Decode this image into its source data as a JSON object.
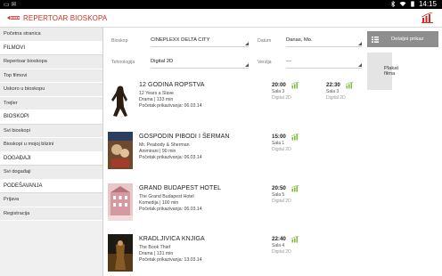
{
  "status_bar": {
    "left_text": "▭ ✉",
    "time": "14:15"
  },
  "app": {
    "title": "REPERTOAR BIOSKOPA",
    "accent": "#d52b1e"
  },
  "sidebar": {
    "rows": [
      {
        "label": "Početna stranica",
        "kind": "item"
      },
      {
        "label": "FILMOVI",
        "kind": "header"
      },
      {
        "label": "Repertoar bioskopa",
        "kind": "item"
      },
      {
        "label": "Top filmovi",
        "kind": "item"
      },
      {
        "label": "Uskoro u bioskopu",
        "kind": "item"
      },
      {
        "label": "Trejler",
        "kind": "item"
      },
      {
        "label": "BIOSKOPI",
        "kind": "header"
      },
      {
        "label": "Svi bioskopi",
        "kind": "item"
      },
      {
        "label": "Bioskopi u mojoj blizini",
        "kind": "item"
      },
      {
        "label": "DOGAĐAJI",
        "kind": "header"
      },
      {
        "label": "Svi događaji",
        "kind": "item"
      },
      {
        "label": "PODEŠAVANJA",
        "kind": "header"
      },
      {
        "label": "Prijava",
        "kind": "item"
      },
      {
        "label": "Registracija",
        "kind": "item"
      }
    ]
  },
  "filters": {
    "cinema_label": "Bioskop",
    "cinema_value": "CINEPLEXX DELTA CITY",
    "date_label": "Datum",
    "date_value": "Danas, Mo.",
    "tech_label": "Tehnologija",
    "tech_value": "Digital 2D",
    "version_label": "Verzija",
    "version_value": "---"
  },
  "view_buttons": {
    "detail": "Detaljni prikaz",
    "poster": "Plakat filma"
  },
  "movies": [
    {
      "title": "12 GODINA ROPSTVA",
      "original": "12 Years a Slave",
      "genre": "Drama | 133 min",
      "start": "Početak prikazivanja: 06.03.14",
      "shows": [
        {
          "time": "20:00",
          "hall": "Sala 3",
          "format": "Digital 2D"
        },
        {
          "time": "22:30",
          "hall": "Sala 3",
          "format": "Digital 2D"
        }
      ]
    },
    {
      "title": "GOSPODIN PIBODI I ŠERMAN",
      "original": "Mr. Peabody & Sherman",
      "genre": "Animirani | 90 min",
      "start": "Početak prikazivanja: 06.03.14",
      "shows": [
        {
          "time": "15:00",
          "hall": "Sala 1",
          "format": "Digital 2D"
        }
      ]
    },
    {
      "title": "GRAND BUDAPEST HOTEL",
      "original": "The Grand Budapest Hotel",
      "genre": "Komedija | 100 min",
      "start": "Početak prikazivanja: 06.03.14",
      "shows": [
        {
          "time": "20:50",
          "hall": "Sala 5",
          "format": "Digital 2D"
        }
      ]
    },
    {
      "title": "KRADLJIVICA KNJIGA",
      "original": "The Book Thief",
      "genre": "Drama | 131 min",
      "start": "Početak prikazivanja: 13.03.14",
      "shows": [
        {
          "time": "22:40",
          "hall": "Sala 4",
          "format": "Digital 2D"
        }
      ]
    }
  ]
}
